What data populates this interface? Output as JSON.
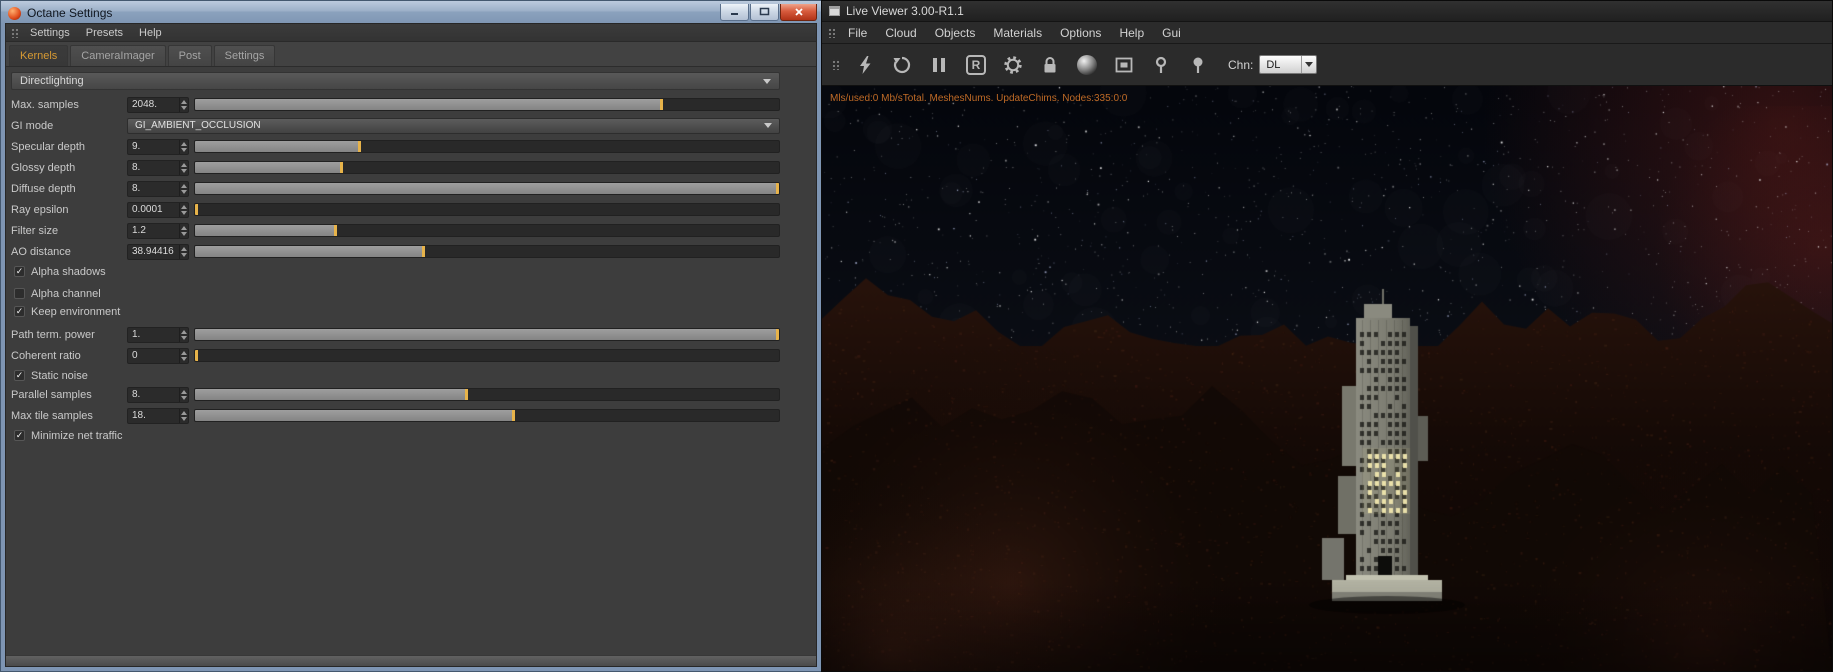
{
  "colors": {
    "accent_tab": "#d79a33",
    "slider_marker": "#e7b34a",
    "status_text": "#bf6a26"
  },
  "octane": {
    "title": "Octane Settings",
    "menus": [
      "Settings",
      "Presets",
      "Help"
    ],
    "tabs": [
      "Kernels",
      "CameraImager",
      "Post",
      "Settings"
    ],
    "active_tab": "Kernels",
    "section": "Directlighting",
    "params": [
      {
        "label": "Max. samples",
        "value": "2048.",
        "fill": 0.8,
        "type": "slider"
      },
      {
        "label": "GI mode",
        "value": "GI_AMBIENT_OCCLUSION",
        "type": "dropdown"
      },
      {
        "label": "Specular depth",
        "value": "9.",
        "fill": 0.28,
        "type": "slider"
      },
      {
        "label": "Glossy depth",
        "value": "8.",
        "fill": 0.25,
        "type": "slider"
      },
      {
        "label": "Diffuse depth",
        "value": "8.",
        "fill": 1,
        "type": "slider"
      },
      {
        "label": "Ray epsilon",
        "value": "0.0001",
        "fill": 0,
        "type": "slider"
      },
      {
        "label": "Filter size",
        "value": "1.2",
        "fill": 0.24,
        "type": "slider"
      },
      {
        "label": "AO distance",
        "value": "38.94416",
        "fill": 0.39,
        "type": "slider"
      },
      {
        "label": "Path term. power",
        "value": "1.",
        "fill": 1,
        "type": "slider"
      },
      {
        "label": "Coherent ratio",
        "value": "0",
        "fill": 0,
        "type": "slider"
      },
      {
        "label": "Parallel samples",
        "value": "8.",
        "fill": 0.465,
        "type": "slider"
      },
      {
        "label": "Max tile samples",
        "value": "18.",
        "fill": 0.545,
        "type": "slider"
      }
    ],
    "checks": [
      {
        "label": "Alpha shadows",
        "checked": true
      },
      {
        "label": "Alpha channel",
        "checked": false
      },
      {
        "label": "Keep environment",
        "checked": true
      },
      {
        "label": "Static noise",
        "checked": true
      },
      {
        "label": "Minimize net traffic",
        "checked": true
      }
    ]
  },
  "viewer": {
    "title": "Live Viewer 3.00-R1.1",
    "menus": [
      "File",
      "Cloud",
      "Objects",
      "Materials",
      "Options",
      "Help",
      "Gui"
    ],
    "toolbar": {
      "icon_names": [
        "sync-bolt-icon",
        "restart-icon",
        "pause-icon",
        "reset-icon",
        "gear-icon",
        "lock-icon",
        "render-ball-icon",
        "region-icon",
        "material-picker-icon",
        "focus-picker-icon"
      ],
      "reset_glyph": "R",
      "channel_label": "Chn:",
      "channel_value": "DL"
    },
    "status_text": "Mls/used:0 Mb/sTotal. MeshesNums. UpdateChims. Nodes:335:0:0"
  }
}
